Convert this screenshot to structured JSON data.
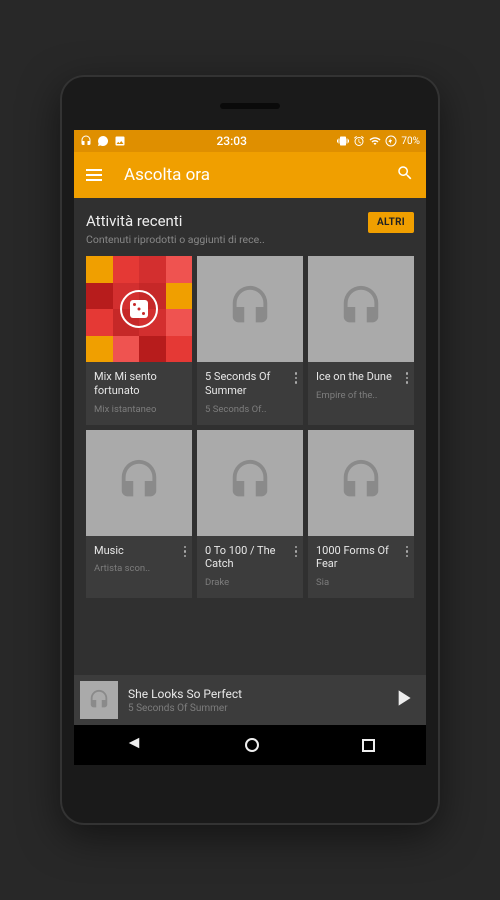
{
  "status": {
    "time": "23:03",
    "battery": "70%"
  },
  "appbar": {
    "title": "Ascolta ora"
  },
  "section": {
    "title": "Attività recenti",
    "subtitle": "Contenuti riprodotti o aggiunti di rece..",
    "more_label": "ALTRI"
  },
  "cards": [
    {
      "title": "Mix Mi sento fortunato",
      "subtitle": "Mix istantaneo",
      "type": "lucky"
    },
    {
      "title": "5 Seconds Of Summer",
      "subtitle": "5 Seconds Of..",
      "type": "album"
    },
    {
      "title": "Ice on the Dune",
      "subtitle": "Empire of the..",
      "type": "album"
    },
    {
      "title": "Music",
      "subtitle": "Artista scon..",
      "type": "album"
    },
    {
      "title": "0 To 100 / The Catch",
      "subtitle": "Drake",
      "type": "album"
    },
    {
      "title": "1000 Forms Of Fear",
      "subtitle": "Sia",
      "type": "album"
    }
  ],
  "now_playing": {
    "title": "She Looks So Perfect",
    "artist": "5 Seconds Of Summer"
  },
  "mosaic_colors": [
    "#f09f00",
    "#e53935",
    "#d32f2f",
    "#ef5350",
    "#b71c1c",
    "#d32f2f",
    "#c62828",
    "#f09f00",
    "#e53935",
    "#c62828",
    "#d32f2f",
    "#ef5350",
    "#f09f00",
    "#ef5350",
    "#b71c1c",
    "#e53935"
  ]
}
